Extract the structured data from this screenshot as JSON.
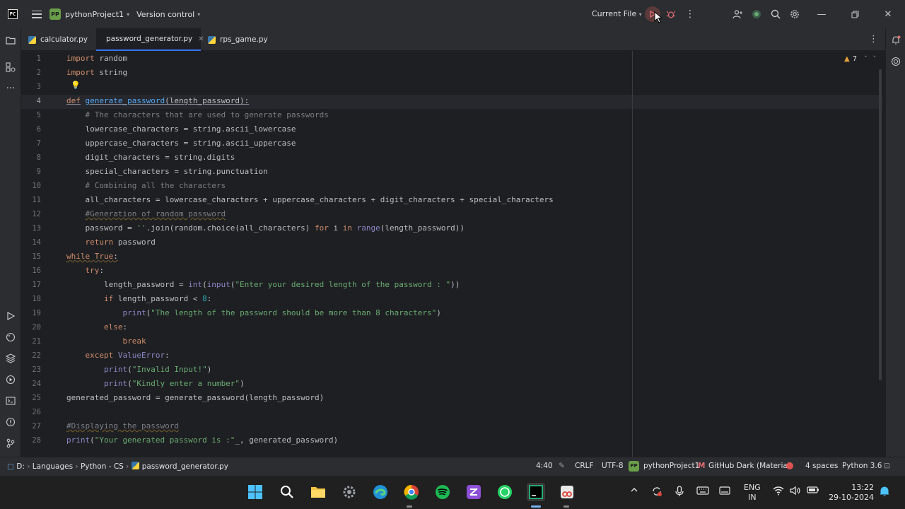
{
  "titlebar": {
    "app_logo": "PC",
    "project_badge": "PP",
    "project_name": "pythonProject1",
    "vcs_label": "Version control",
    "run_config": "Current File"
  },
  "tabs": [
    {
      "label": "calculator.py",
      "active": false
    },
    {
      "label": "password_generator.py",
      "active": true
    },
    {
      "label": "rps_game.py",
      "active": false
    }
  ],
  "editor": {
    "warning_count": "7",
    "current_line": "4",
    "line_numbers": [
      "1",
      "2",
      "3",
      "4",
      "5",
      "6",
      "7",
      "8",
      "9",
      "10",
      "11",
      "12",
      "13",
      "14",
      "15",
      "16",
      "17",
      "18",
      "19",
      "20",
      "21",
      "22",
      "23",
      "24",
      "25",
      "26",
      "27",
      "28"
    ]
  },
  "statusbar": {
    "crumb_root": "D:",
    "crumb_1": "Languages",
    "crumb_2": "Python - CS",
    "crumb_file": "password_generator.py",
    "position": "4:40",
    "line_sep": "CRLF",
    "encoding": "UTF-8",
    "interpreter_badge": "PP",
    "project": "pythonProject1",
    "theme": "GitHub Dark (Material)",
    "indent": "4 spaces",
    "python": "Python 3.6"
  },
  "taskbar": {
    "lang_top": "ENG",
    "lang_bottom": "IN",
    "time": "13:22",
    "date": "29-10-2024"
  },
  "colors": {
    "accent": "#3574f0",
    "keyword": "#cf8e6d",
    "function": "#56a8f5",
    "string": "#6aab73",
    "comment": "#7a7e85",
    "number": "#2aacb8"
  }
}
